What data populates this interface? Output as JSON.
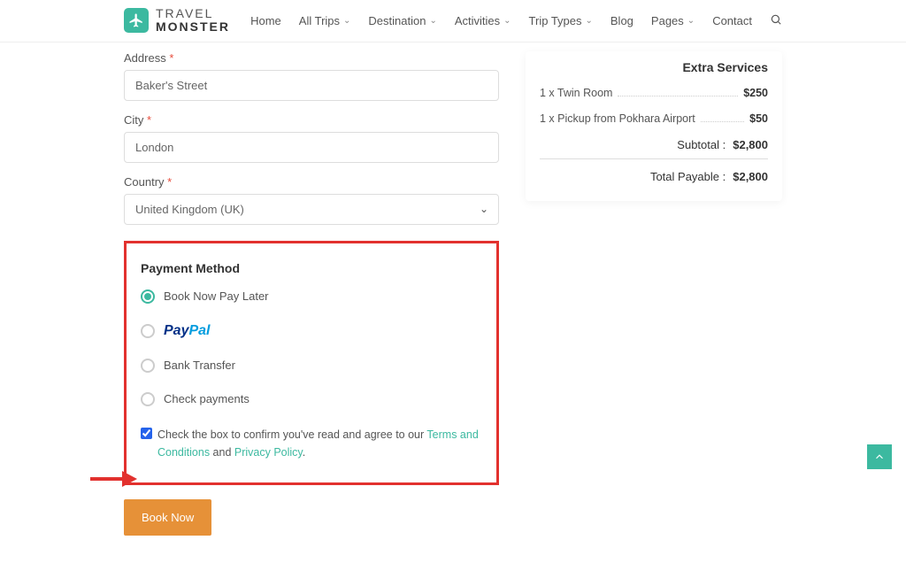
{
  "brand": {
    "line1": "TRAVEL",
    "line2": "MONSTER"
  },
  "nav": {
    "home": "Home",
    "allTrips": "All Trips",
    "destination": "Destination",
    "activities": "Activities",
    "tripTypes": "Trip Types",
    "blog": "Blog",
    "pages": "Pages",
    "contact": "Contact"
  },
  "form": {
    "addressLabel": "Address",
    "addressValue": "Baker's Street",
    "cityLabel": "City",
    "cityValue": "London",
    "countryLabel": "Country",
    "countryValue": "United Kingdom (UK)"
  },
  "payment": {
    "title": "Payment Method",
    "opt1": "Book Now Pay Later",
    "opt2_pay": "Pay",
    "opt2_pal": "Pal",
    "opt3": "Bank Transfer",
    "opt4": "Check payments",
    "termsPre": "Check the box to confirm you've read and agree to our ",
    "termsLink": "Terms and Conditions",
    "termsMid": " and ",
    "privacyLink": "Privacy Policy",
    "termsEnd": "."
  },
  "bookBtn": "Book Now",
  "summary": {
    "extraTitle": "Extra Services",
    "items": [
      {
        "label": "1 x Twin Room",
        "value": "$250"
      },
      {
        "label": "1 x Pickup from Pokhara Airport",
        "value": "$50"
      }
    ],
    "subtotalLabel": "Subtotal : ",
    "subtotalValue": "$2,800",
    "payableLabel": "Total Payable : ",
    "payableValue": "$2,800"
  }
}
